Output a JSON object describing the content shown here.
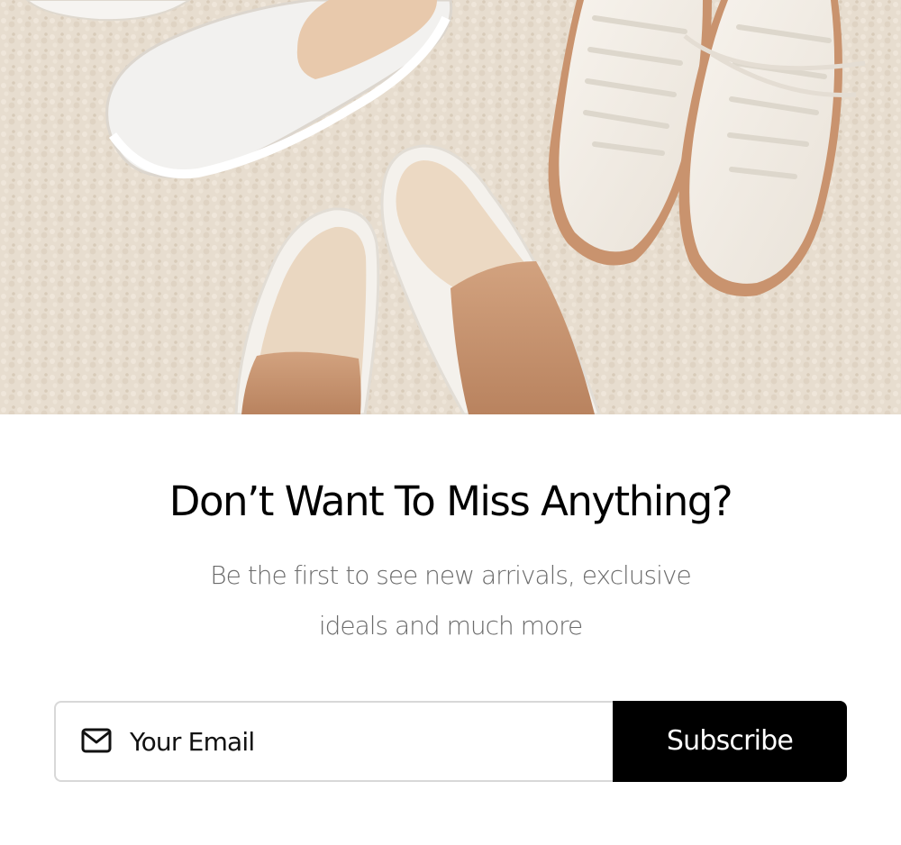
{
  "popup": {
    "title": "Don’t Want To Miss Anything?",
    "subtitle_lines": [
      "Be the first to see new arrivals, exclusive",
      "ideals and much more"
    ],
    "email_placeholder": "Your Email",
    "email_value": "",
    "subscribe_label": "Subscribe",
    "email_icon": "mail-icon",
    "colors": {
      "button": "#000000",
      "button_text": "#ffffff",
      "title": "#000000",
      "subtitle": "#6b6b6b",
      "input_border": "#d8d8d8",
      "carpet": "#e6dccd",
      "tan_suede": "#c89572",
      "cream_canvas": "#f1ece4",
      "rubber_sole": "#c9936e"
    }
  }
}
